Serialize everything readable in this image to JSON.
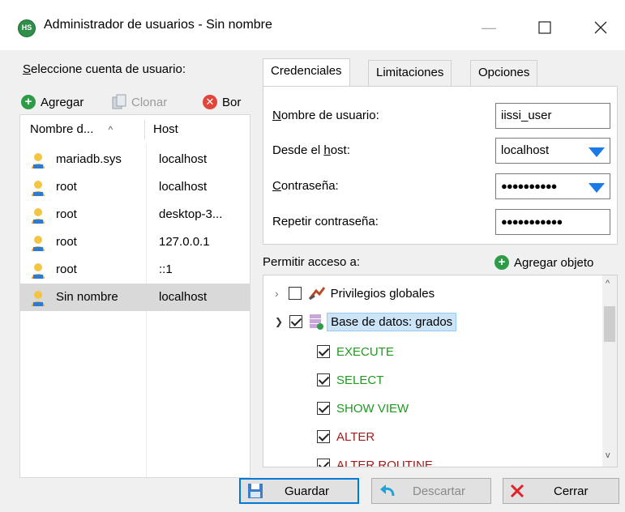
{
  "window": {
    "title": "Administrador de usuarios - Sin nombre",
    "app_icon_text": "HS"
  },
  "left_panel": {
    "select_label_first": "S",
    "select_label_rest": "eleccione cuenta de usuario:",
    "toolbar": {
      "add": "Agregar",
      "clone": "Clonar",
      "delete": "Bor"
    },
    "columns": {
      "name": "Nombre d...",
      "name_sort": "^",
      "host": "Host"
    },
    "users": [
      {
        "name": "mariadb.sys",
        "host": "localhost"
      },
      {
        "name": "root",
        "host": "localhost"
      },
      {
        "name": "root",
        "host": "desktop-3..."
      },
      {
        "name": "root",
        "host": "127.0.0.1"
      },
      {
        "name": "root",
        "host": "::1"
      },
      {
        "name": "Sin nombre",
        "host": "localhost",
        "selected": true
      }
    ]
  },
  "tabs": [
    {
      "label": "Credenciales",
      "active": true
    },
    {
      "label": "Limitaciones"
    },
    {
      "label": "Opciones SSL"
    }
  ],
  "credentials": {
    "username_label_first": "N",
    "username_label_rest": "ombre de usuario:",
    "username_value": "iissi_user",
    "host_label_before": "Desde el ",
    "host_label_ul": "h",
    "host_label_after": "ost:",
    "host_value": "localhost",
    "password_label_first": "C",
    "password_label_rest": "ontraseña:",
    "password_value": "●●●●●●●●●●",
    "repeat_label": "Repetir contraseña:",
    "repeat_value": "●●●●●●●●●●●"
  },
  "access": {
    "label": "Permitir acceso a:",
    "add_object": "Agregar objeto",
    "global_privileges": "Privilegios globales",
    "database": "Base de datos: grados",
    "privileges": [
      "EXECUTE",
      "SELECT",
      "SHOW VIEW",
      "ALTER",
      "ALTER ROUTINE"
    ]
  },
  "buttons": {
    "save": "Guardar",
    "discard": "Descartar",
    "close": "Cerrar"
  },
  "colors": {
    "accent": "#0078d7",
    "green_add": "#2e9c46",
    "red_delete": "#e2463a",
    "privilege_green": "#1f9a1f",
    "privilege_red": "#a01c1c",
    "selection": "#cce4f7"
  }
}
